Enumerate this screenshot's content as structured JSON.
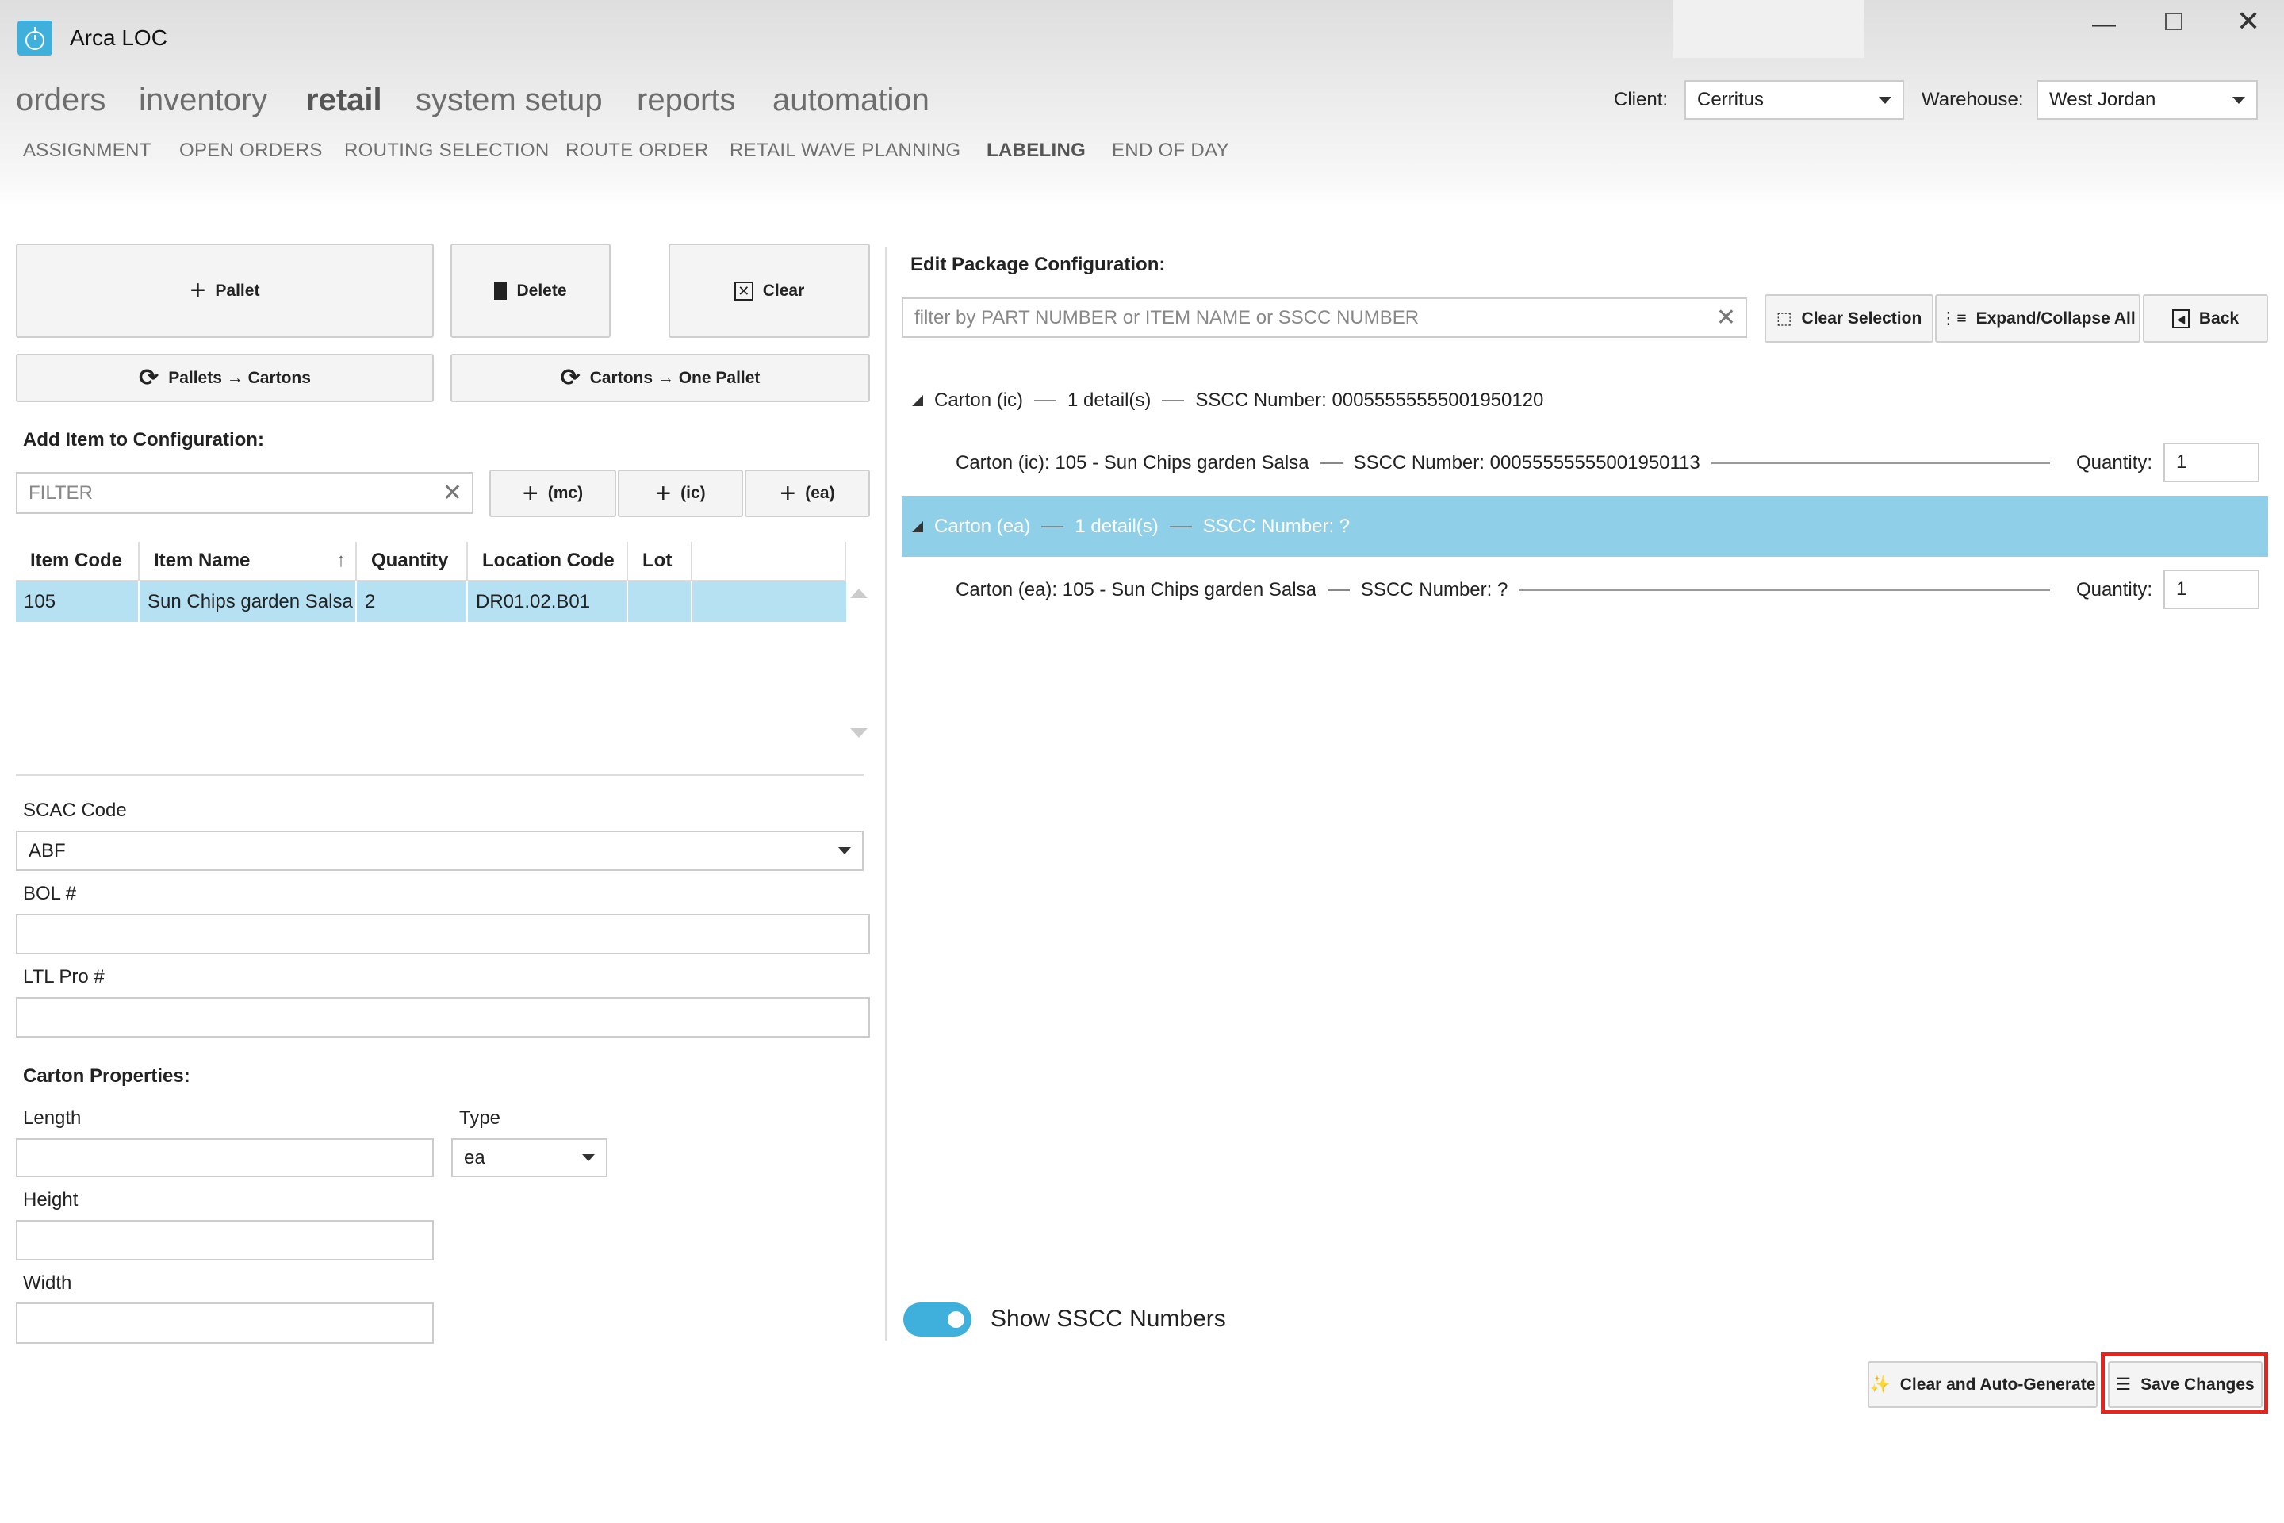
{
  "app": {
    "title": "Arca LOC",
    "icon": "stopwatch-icon",
    "accent": "#3fb0dc"
  },
  "nav": {
    "main": [
      "orders",
      "inventory",
      "retail",
      "system setup",
      "reports",
      "automation"
    ],
    "active": "retail",
    "sub": [
      "ASSIGNMENT",
      "OPEN ORDERS",
      "ROUTING SELECTION",
      "ROUTE ORDER",
      "RETAIL WAVE PLANNING",
      "LABELING",
      "END OF DAY"
    ],
    "active_sub": "LABELING"
  },
  "header": {
    "client_label": "Client:",
    "client_value": "Cerritus",
    "warehouse_label": "Warehouse:",
    "warehouse_value": "West Jordan"
  },
  "left": {
    "buttons": {
      "pallet": "Pallet",
      "delete": "Delete",
      "clear": "Clear",
      "pallets_to_cartons": "Pallets → Cartons",
      "cartons_to_pallet": "Cartons → One Pallet"
    },
    "add_item_title": "Add Item to Configuration:",
    "filter_placeholder": "FILTER",
    "add_buttons": [
      "(mc)",
      "(ic)",
      "(ea)"
    ],
    "table": {
      "columns": [
        "Item Code",
        "Item Name",
        "Quantity",
        "Location Code",
        "Lot"
      ],
      "sort_column": "Item Name",
      "sort": "ascending",
      "rows": [
        [
          "105",
          "Sun Chips garden Salsa",
          "2",
          "DR01.02.B01",
          ""
        ]
      ]
    },
    "scac_label": "SCAC Code",
    "scac_value": "ABF",
    "bol_label": "BOL #",
    "bol_value": "",
    "ltl_label": "LTL Pro #",
    "ltl_value": "",
    "carton_title": "Carton Properties:",
    "length_label": "Length",
    "length_value": "",
    "type_label": "Type",
    "type_value": "ea",
    "height_label": "Height",
    "height_value": "",
    "width_label": "Width",
    "width_value": ""
  },
  "right": {
    "title": "Edit Package Configuration:",
    "filter_placeholder": "filter by PART NUMBER or ITEM NAME or SSCC NUMBER",
    "buttons": {
      "clear_selection": "Clear Selection",
      "expand_collapse": "Expand/Collapse All",
      "back": "Back"
    },
    "tree": [
      {
        "label": "Carton (ic)",
        "details": "1 detail(s)",
        "sscc": "SSCC Number: 00055555555001950120",
        "selected": false,
        "child": {
          "label": "Carton (ic): 105  -  Sun Chips garden Salsa",
          "sscc": "SSCC Number: 00055555555001950113",
          "qty_label": "Quantity:",
          "qty": "1"
        }
      },
      {
        "label": "Carton (ea)",
        "details": "1 detail(s)",
        "sscc": "SSCC Number: ?",
        "selected": true,
        "child": {
          "label": "Carton (ea): 105  -  Sun Chips garden Salsa",
          "sscc": "SSCC Number: ?",
          "qty_label": "Quantity:",
          "qty": "1"
        }
      }
    ],
    "selected_color": "#8fd0e8",
    "toggle_label": "Show SSCC Numbers",
    "toggle_on": true,
    "clear_autogen": "Clear and Auto-Generate",
    "save": "Save Changes",
    "highlight_color": "#e8231c"
  }
}
